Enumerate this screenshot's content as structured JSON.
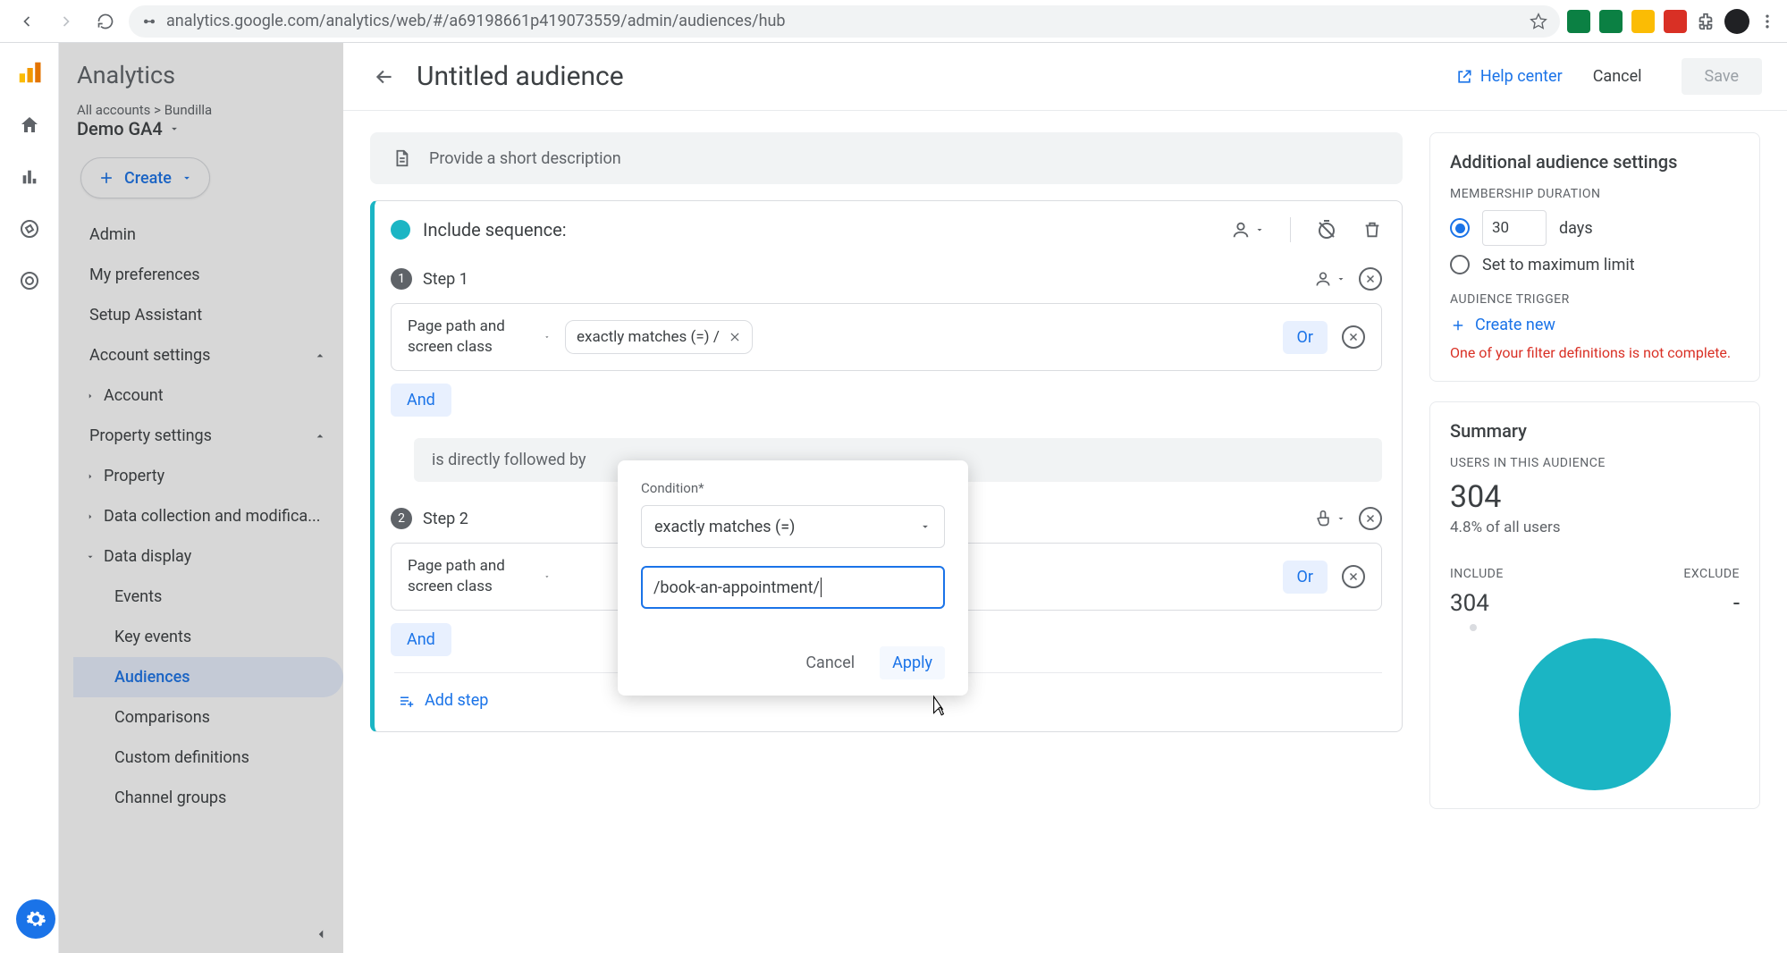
{
  "browser": {
    "url": "analytics.google.com/analytics/web/#/a69198661p419073559/admin/audiences/hub"
  },
  "brand": {
    "name": "Analytics",
    "breadcrumb": "All accounts > Bundilla",
    "property": "Demo GA4"
  },
  "create_label": "Create",
  "nav": {
    "admin": "Admin",
    "prefs": "My preferences",
    "setup": "Setup Assistant",
    "account_settings": "Account settings",
    "account": "Account",
    "property_settings": "Property settings",
    "property": "Property",
    "data_collection": "Data collection and modifica...",
    "data_display": "Data display",
    "events": "Events",
    "key_events": "Key events",
    "audiences": "Audiences",
    "comparisons": "Comparisons",
    "custom_defs": "Custom definitions",
    "channel_groups": "Channel groups"
  },
  "editor": {
    "title": "Untitled audience",
    "help": "Help center",
    "cancel": "Cancel",
    "save": "Save",
    "desc_placeholder": "Provide a short description",
    "include_sequence": "Include sequence:",
    "step1": "Step 1",
    "step2": "Step 2",
    "dimension": "Page path and screen class",
    "chip": "exactly matches (=) /",
    "followed_by": "is directly followed by",
    "or": "Or",
    "and": "And",
    "add_step": "Add step"
  },
  "popover": {
    "label": "Condition*",
    "operator": "exactly matches (=)",
    "value": "/book-an-appointment/",
    "cancel": "Cancel",
    "apply": "Apply"
  },
  "settings": {
    "title": "Additional audience settings",
    "membership": "MEMBERSHIP DURATION",
    "days_value": "30",
    "days_label": "days",
    "max_limit": "Set to maximum limit",
    "trigger": "AUDIENCE TRIGGER",
    "create_new": "Create new",
    "warning": "One of your filter definitions is not complete."
  },
  "summary": {
    "title": "Summary",
    "users_label": "USERS IN THIS AUDIENCE",
    "users": "304",
    "percent": "4.8% of all users",
    "include_label": "INCLUDE",
    "include_val": "304",
    "exclude_label": "EXCLUDE",
    "exclude_val": "-"
  }
}
